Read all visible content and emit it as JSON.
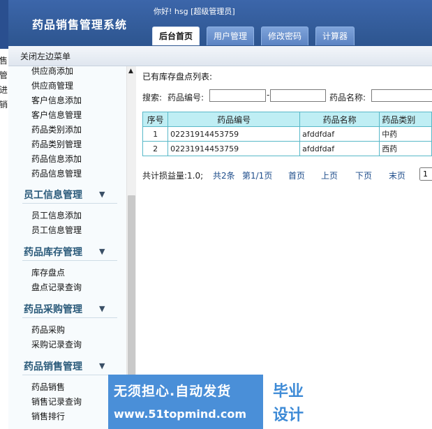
{
  "app": {
    "title": "药品销售管理系统",
    "greeting": "你好! hsg [超级管理员]"
  },
  "tabs": [
    {
      "label": "后台首页",
      "active": true
    },
    {
      "label": "用户管理",
      "active": false
    },
    {
      "label": "修改密码",
      "active": false
    },
    {
      "label": "计算器",
      "active": false
    }
  ],
  "toolbar": {
    "close_left_menu": "关闭左边菜单"
  },
  "left_strip": [
    "售",
    "管",
    "进",
    "销"
  ],
  "sidebar": {
    "top_items": [
      "供应商添加",
      "供应商管理",
      "客户信息添加",
      "客户信息管理",
      "药品类别添加",
      "药品类别管理",
      "药品信息添加",
      "药品信息管理"
    ],
    "groups": [
      {
        "title": "员工信息管理",
        "items": [
          "员工信息添加",
          "员工信息管理"
        ]
      },
      {
        "title": "药品库存管理",
        "items": [
          "库存盘点",
          "盘点记录查询"
        ]
      },
      {
        "title": "药品采购管理",
        "items": [
          "药品采购",
          "采购记录查询"
        ]
      },
      {
        "title": "药品销售管理",
        "items": [
          "药品销售",
          "销售记录查询",
          "销售排行"
        ]
      }
    ]
  },
  "main": {
    "list_title": "已有库存盘点列表:",
    "search": {
      "label": "搜索:",
      "code_label": "药品编号:",
      "code_from": "",
      "code_to": "",
      "name_label": "药品名称:",
      "name_value": ""
    },
    "table": {
      "columns": [
        "序号",
        "药品编号",
        "药品名称",
        "药品类别"
      ],
      "rows": [
        [
          "1",
          "02231914453759",
          "afddfdaf",
          "中药"
        ],
        [
          "2",
          "02231914453759",
          "afddfdaf",
          "西药"
        ]
      ]
    },
    "pager": {
      "summary": "共计损益量:1.0;",
      "total": "共2条",
      "page_info": "第1/1页",
      "first": "首页",
      "prev": "上页",
      "next": "下页",
      "last": "末页",
      "page_select": "1"
    }
  },
  "watermark": {
    "line1": "无须担心.自动发货",
    "line2": "www.51topmind.com",
    "seal_line1": "毕业",
    "seal_line2": "设计"
  },
  "colors": {
    "header": "#2d558f",
    "table_header": "#bfeef4",
    "table_border": "#58b8c8",
    "link": "#1d4c8a",
    "group_title": "#2a5a7a",
    "watermark_bg": "#4a8fd8"
  }
}
